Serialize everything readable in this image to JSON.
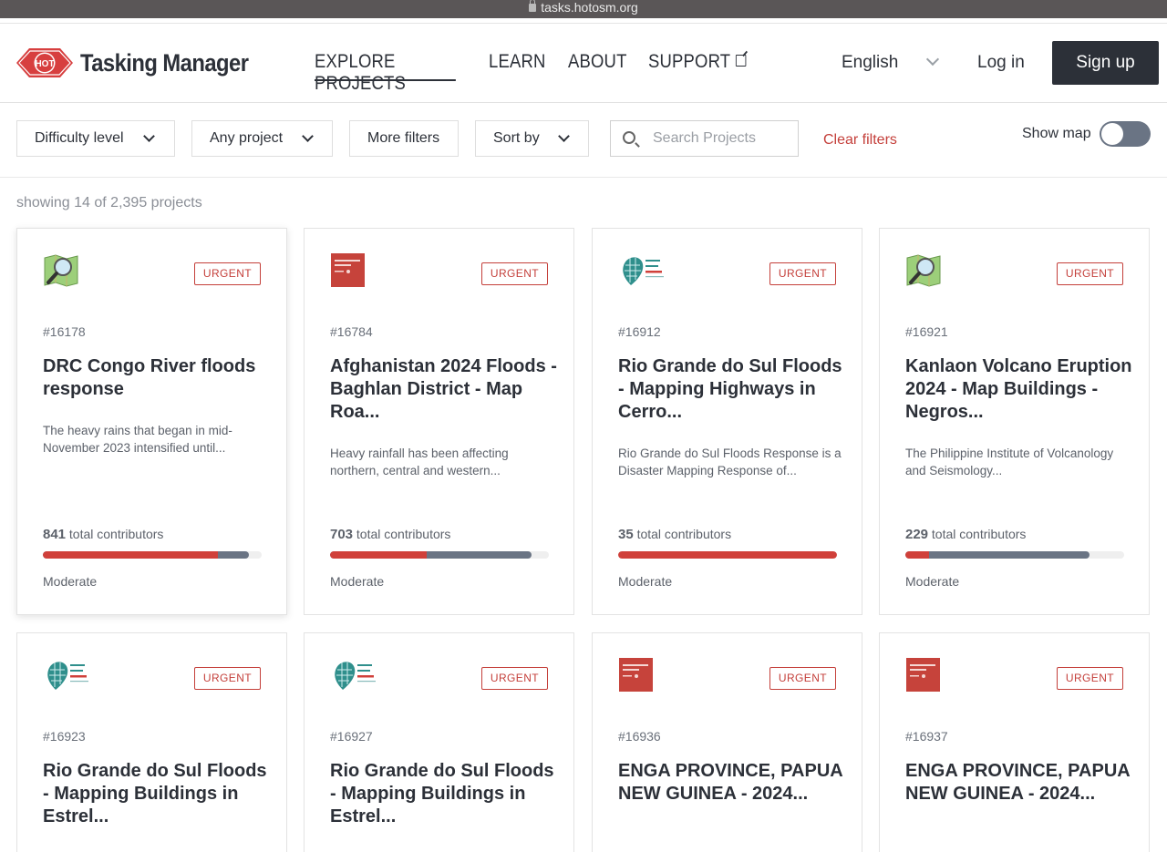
{
  "browser": {
    "url": "tasks.hotosm.org"
  },
  "header": {
    "brand": "Tasking Manager",
    "logo_text": "HOT",
    "nav": [
      "EXPLORE PROJECTS",
      "LEARN",
      "ABOUT",
      "SUPPORT"
    ],
    "language": "English",
    "login": "Log in",
    "signup": "Sign up"
  },
  "filters": {
    "difficulty": "Difficulty level",
    "project": "Any project",
    "more": "More filters",
    "sort": "Sort by",
    "search_placeholder": "Search Projects",
    "clear": "Clear filters",
    "show_map": "Show map",
    "show_map_on": false
  },
  "count_text": "showing 14 of 2,395 projects",
  "colors": {
    "accent": "#d73f3f",
    "dark": "#2c3038",
    "validated": "#6a7484"
  },
  "projects": [
    {
      "id": "#16178",
      "badge": "URGENT",
      "title": "DRC Congo River floods response",
      "description": "The heavy rains that began in mid-November 2023 intensified until...",
      "contributors": "841",
      "contributors_label": "total contributors",
      "mapped": 0.8,
      "validated": 0.94,
      "difficulty": "Moderate",
      "org_icon": "map-magnifier-icon"
    },
    {
      "id": "#16784",
      "badge": "URGENT",
      "title": "Afghanistan 2024 Floods - Baghlan District - Map Roa...",
      "description": "Heavy rainfall has been affecting northern, central and western...",
      "contributors": "703",
      "contributors_label": "total contributors",
      "mapped": 0.44,
      "validated": 0.92,
      "difficulty": "Moderate",
      "org_icon": "open-mapping-hub-asia-pacific-logo"
    },
    {
      "id": "#16912",
      "badge": "URGENT",
      "title": "Rio Grande do Sul Floods - Mapping Highways in Cerro...",
      "description": "Rio Grande do Sul Floods Response is a Disaster Mapping Response of...",
      "contributors": "35",
      "contributors_label": "total contributors",
      "mapped": 1.0,
      "validated": 0.0,
      "difficulty": "Moderate",
      "org_icon": "hub-de-mapeo-abierto-logo"
    },
    {
      "id": "#16921",
      "badge": "URGENT",
      "title": "Kanlaon Volcano Eruption 2024 - Map Buildings - Negros...",
      "description": "The Philippine Institute of Volcanology and Seismology...",
      "contributors": "229",
      "contributors_label": "total contributors",
      "mapped": 0.11,
      "validated": 0.84,
      "difficulty": "Moderate",
      "org_icon": "map-magnifier-icon"
    },
    {
      "id": "#16923",
      "badge": "URGENT",
      "title": "Rio Grande do Sul Floods - Mapping Buildings in Estrel...",
      "org_icon": "hub-de-mapeo-abierto-logo"
    },
    {
      "id": "#16927",
      "badge": "URGENT",
      "title": "Rio Grande do Sul Floods - Mapping Buildings in Estrel...",
      "org_icon": "hub-de-mapeo-abierto-logo"
    },
    {
      "id": "#16936",
      "badge": "URGENT",
      "title": "ENGA PROVINCE, PAPUA NEW GUINEA - 2024...",
      "org_icon": "open-mapping-hub-asia-pacific-logo"
    },
    {
      "id": "#16937",
      "badge": "URGENT",
      "title": "ENGA PROVINCE, PAPUA NEW GUINEA - 2024...",
      "org_icon": "open-mapping-hub-asia-pacific-logo"
    }
  ]
}
